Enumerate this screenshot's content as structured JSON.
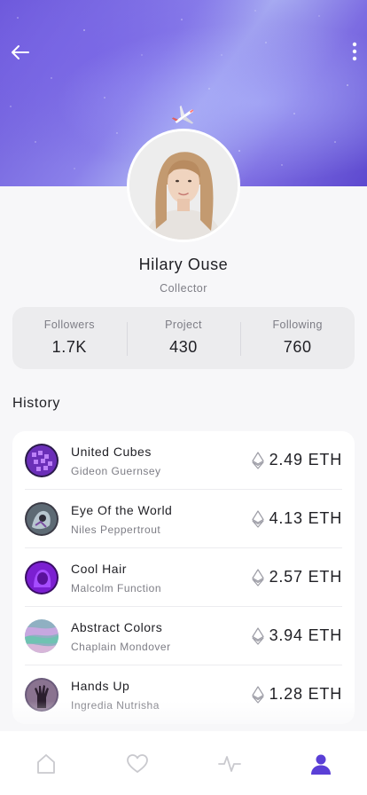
{
  "profile": {
    "name": "Hilary Ouse",
    "role": "Collector"
  },
  "stats": [
    {
      "label": "Followers",
      "value": "1.7K"
    },
    {
      "label": "Project",
      "value": "430"
    },
    {
      "label": "Following",
      "value": "760"
    }
  ],
  "history": {
    "title": "History",
    "items": [
      {
        "title": "United Cubes",
        "author": "Gideon Guernsey",
        "price": "2.49 ETH"
      },
      {
        "title": "Eye Of the World",
        "author": "Niles Peppertrout",
        "price": "4.13 ETH"
      },
      {
        "title": "Cool Hair",
        "author": "Malcolm Function",
        "price": "2.57 ETH"
      },
      {
        "title": "Abstract Colors",
        "author": "Chaplain Mondover",
        "price": "3.94 ETH"
      },
      {
        "title": "Hands Up",
        "author": "Ingredia Nutrisha",
        "price": "1.28 ETH"
      }
    ]
  },
  "icons": {
    "back": "arrow-left-icon",
    "more": "more-vertical-icon",
    "header_decoration": "airplane-icon",
    "currency": "ethereum-icon",
    "tabs": [
      "home-icon",
      "heart-icon",
      "activity-icon",
      "profile-icon"
    ]
  },
  "colors": {
    "accent": "#5a3fd6",
    "hero_base": "#7d6de2",
    "tab_inactive": "#c9c9ce",
    "text_primary": "#1f1f24",
    "text_secondary": "#7d7d85"
  },
  "tabbar": {
    "active_index": 3
  }
}
